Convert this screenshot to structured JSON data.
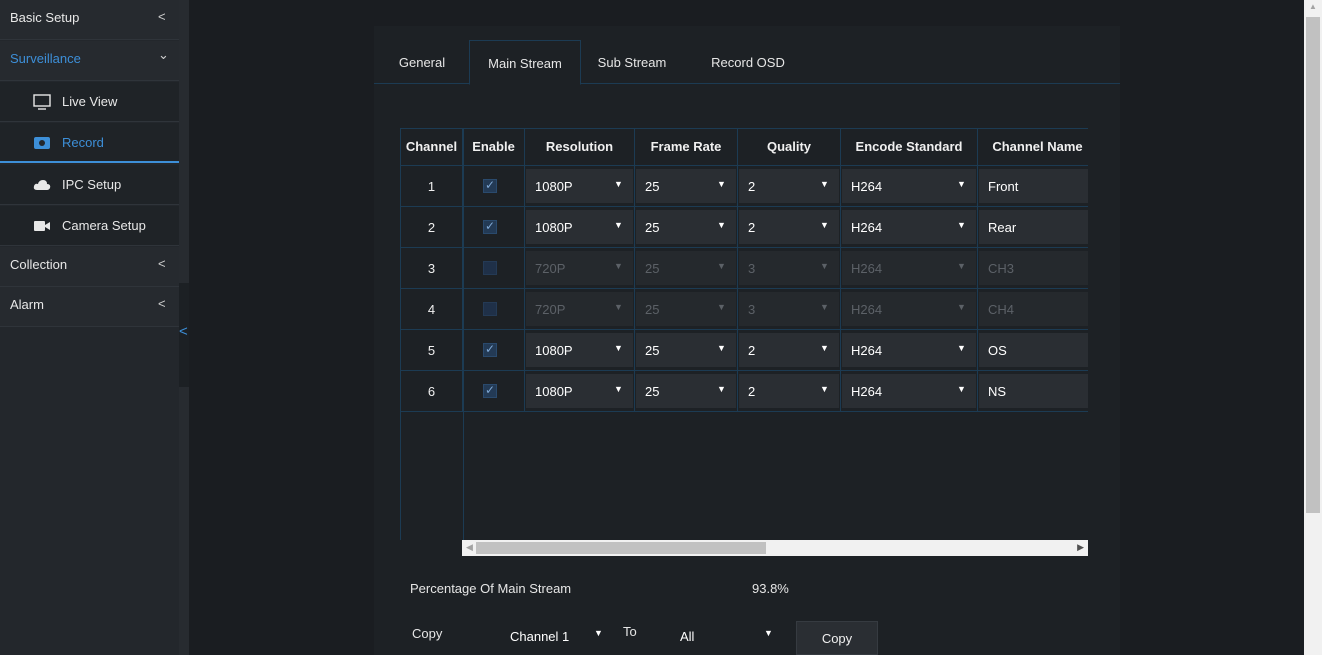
{
  "sidebar": {
    "groups": [
      {
        "label": "Basic Setup",
        "chev": "<"
      },
      {
        "label": "Surveillance",
        "chev": "⌄"
      },
      {
        "label": "Collection",
        "chev": "<"
      },
      {
        "label": "Alarm",
        "chev": "<"
      }
    ],
    "items": [
      {
        "label": "Live View",
        "icon": "monitor-icon"
      },
      {
        "label": "Record",
        "icon": "record-icon"
      },
      {
        "label": "IPC Setup",
        "icon": "cloud-icon"
      },
      {
        "label": "Camera Setup",
        "icon": "video-camera-icon"
      }
    ],
    "handle_glyph": "<",
    "accent": "#3d8fd8"
  },
  "tabs": [
    "General",
    "Main Stream",
    "Sub Stream",
    "Record OSD"
  ],
  "table": {
    "headers": [
      "Channel",
      "Enable",
      "Resolution",
      "Frame Rate",
      "Quality",
      "Encode Standard",
      "Channel Name"
    ],
    "rows": [
      {
        "channel": "1",
        "enabled": true,
        "resolution": "1080P",
        "frame_rate": "25",
        "quality": "2",
        "encode": "H264",
        "name": "Front"
      },
      {
        "channel": "2",
        "enabled": true,
        "resolution": "1080P",
        "frame_rate": "25",
        "quality": "2",
        "encode": "H264",
        "name": "Rear"
      },
      {
        "channel": "3",
        "enabled": false,
        "resolution": "720P",
        "frame_rate": "25",
        "quality": "3",
        "encode": "H264",
        "name": "CH3"
      },
      {
        "channel": "4",
        "enabled": false,
        "resolution": "720P",
        "frame_rate": "25",
        "quality": "3",
        "encode": "H264",
        "name": "CH4"
      },
      {
        "channel": "5",
        "enabled": true,
        "resolution": "1080P",
        "frame_rate": "25",
        "quality": "2",
        "encode": "H264",
        "name": "OS"
      },
      {
        "channel": "6",
        "enabled": true,
        "resolution": "1080P",
        "frame_rate": "25",
        "quality": "2",
        "encode": "H264",
        "name": "NS"
      }
    ]
  },
  "footer": {
    "percentage_label": "Percentage Of Main Stream",
    "percentage_value": "93.8%",
    "copy_label": "Copy",
    "copy_from": "Channel 1",
    "to_label": "To",
    "copy_to": "All",
    "copy_button": "Copy"
  },
  "glyphs": {
    "arrow_down": "▼",
    "check": "✓",
    "scroll_left": "◀",
    "scroll_right": "▶",
    "scroll_up": "▲"
  }
}
